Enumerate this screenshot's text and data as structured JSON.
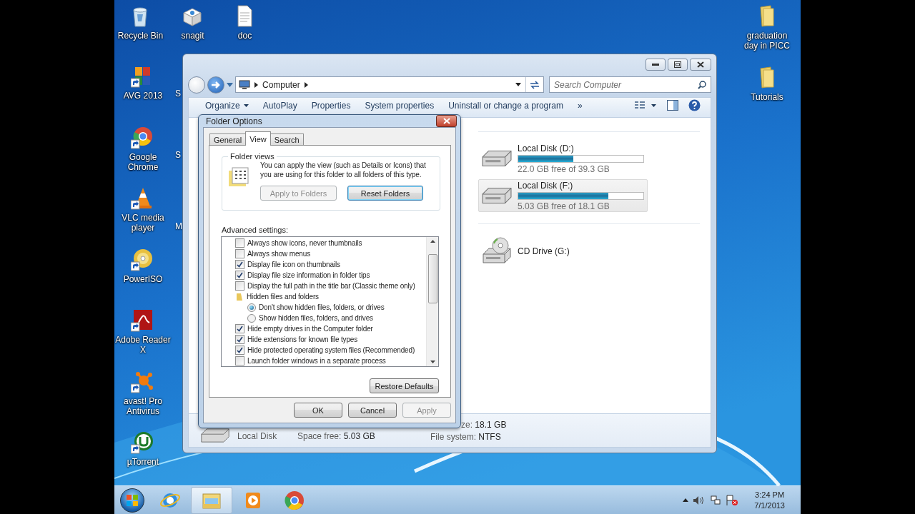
{
  "desktop": {
    "top_row": [
      {
        "label": "Recycle Bin",
        "kind": "bin"
      },
      {
        "label": "snagit",
        "kind": "box"
      },
      {
        "label": "doc",
        "kind": "doc"
      }
    ],
    "left_column": [
      {
        "label": "AVG 2013",
        "kind": "tiles"
      },
      {
        "label": "Google Chrome",
        "kind": "chrome"
      },
      {
        "label": "VLC media player",
        "kind": "cone"
      },
      {
        "label": "PowerISO",
        "kind": "disc"
      },
      {
        "label": "Adobe Reader X",
        "kind": "pdf"
      },
      {
        "label": "avast! Pro Antivirus",
        "kind": "splash"
      },
      {
        "label": "µTorrent",
        "kind": "torrent"
      }
    ],
    "hidden_labels": [
      "S",
      "S",
      "M"
    ],
    "right_column": [
      {
        "label": "graduation day in PICC",
        "kind": "folder"
      },
      {
        "label": "Tutorials",
        "kind": "folder"
      }
    ]
  },
  "explorer": {
    "address": [
      "Computer"
    ],
    "search": {
      "placeholder": "Search Computer"
    },
    "toolbar": [
      {
        "label": "Organize",
        "dropdown": true
      },
      {
        "label": "AutoPlay",
        "dropdown": false
      },
      {
        "label": "Properties",
        "dropdown": false
      },
      {
        "label": "System properties",
        "dropdown": false
      },
      {
        "label": "Uninstall or change a program",
        "dropdown": false
      },
      {
        "label": "»",
        "dropdown": false
      }
    ],
    "drives": [
      {
        "name": "Local Disk (D:)",
        "kind": "hdd",
        "level": 0.44,
        "free": "22.0 GB free of 39.3 GB",
        "selected": false
      },
      {
        "name": "Local Disk (F:)",
        "kind": "hdd",
        "level": 0.72,
        "free": "5.03 GB free of 18.1 GB",
        "selected": true
      },
      {
        "name": "CD Drive (G:)",
        "kind": "cd",
        "selected": false
      }
    ],
    "details": {
      "name": "Local Disk",
      "fields": [
        {
          "label": "Space free:",
          "value": "5.03 GB"
        },
        {
          "label": "ze:",
          "value": "18.1 GB"
        },
        {
          "label": "File system:",
          "value": "NTFS"
        }
      ]
    }
  },
  "dialog": {
    "title": "Folder Options",
    "tabs": [
      {
        "label": "General",
        "selected": false
      },
      {
        "label": "View",
        "selected": true
      },
      {
        "label": "Search",
        "selected": false
      }
    ],
    "folder_views": {
      "legend": "Folder views",
      "description": "You can apply the view (such as Details or Icons) that you are using for this folder to all folders of this type.",
      "buttons": [
        {
          "label": "Apply to Folders",
          "disabled": true,
          "focused": false
        },
        {
          "label": "Reset Folders",
          "disabled": false,
          "focused": true
        }
      ]
    },
    "advanced": {
      "label": "Advanced settings:",
      "items": [
        {
          "kind": "checkbox",
          "label": "Always show icons, never thumbnails",
          "checked": false
        },
        {
          "kind": "checkbox",
          "label": "Always show menus",
          "checked": false
        },
        {
          "kind": "checkbox",
          "label": "Display file icon on thumbnails",
          "checked": true
        },
        {
          "kind": "checkbox",
          "label": "Display file size information in folder tips",
          "checked": true
        },
        {
          "kind": "checkbox",
          "label": "Display the full path in the title bar (Classic theme only)",
          "checked": false
        },
        {
          "kind": "folder",
          "label": "Hidden files and folders",
          "children": [
            {
              "kind": "radio",
              "label": "Don't show hidden files, folders, or drives",
              "selected": true
            },
            {
              "kind": "radio",
              "label": "Show hidden files, folders, and drives",
              "selected": false
            }
          ]
        },
        {
          "kind": "checkbox",
          "label": "Hide empty drives in the Computer folder",
          "checked": true
        },
        {
          "kind": "checkbox",
          "label": "Hide extensions for known file types",
          "checked": true
        },
        {
          "kind": "checkbox",
          "label": "Hide protected operating system files (Recommended)",
          "checked": true
        },
        {
          "kind": "checkbox",
          "label": "Launch folder windows in a separate process",
          "checked": false
        }
      ]
    },
    "restore": "Restore Defaults",
    "footer": [
      {
        "label": "OK",
        "disabled": false
      },
      {
        "label": "Cancel",
        "disabled": false
      },
      {
        "label": "Apply",
        "disabled": true
      }
    ]
  },
  "taskbar": {
    "apps": [
      {
        "kind": "ie",
        "active": false
      },
      {
        "kind": "explorer",
        "active": true
      },
      {
        "kind": "media",
        "active": false
      },
      {
        "kind": "chrome",
        "active": false
      }
    ],
    "time": "3:24 PM",
    "date": "7/1/2013"
  }
}
